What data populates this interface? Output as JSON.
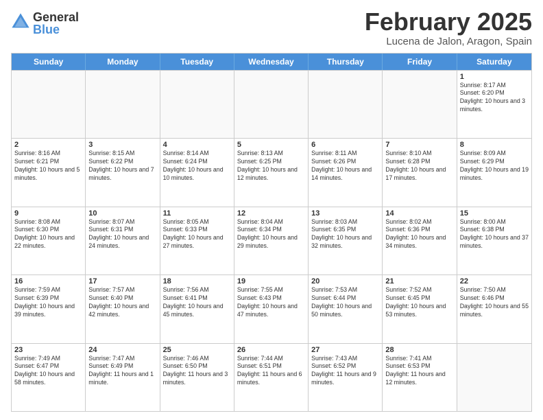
{
  "logo": {
    "general": "General",
    "blue": "Blue"
  },
  "header": {
    "month": "February 2025",
    "location": "Lucena de Jalon, Aragon, Spain"
  },
  "days_of_week": [
    "Sunday",
    "Monday",
    "Tuesday",
    "Wednesday",
    "Thursday",
    "Friday",
    "Saturday"
  ],
  "weeks": [
    [
      {
        "day": "",
        "empty": true
      },
      {
        "day": "",
        "empty": true
      },
      {
        "day": "",
        "empty": true
      },
      {
        "day": "",
        "empty": true
      },
      {
        "day": "",
        "empty": true
      },
      {
        "day": "",
        "empty": true
      },
      {
        "day": "1",
        "info": "Sunrise: 8:17 AM\nSunset: 6:20 PM\nDaylight: 10 hours and 3 minutes."
      }
    ],
    [
      {
        "day": "2",
        "info": "Sunrise: 8:16 AM\nSunset: 6:21 PM\nDaylight: 10 hours and 5 minutes."
      },
      {
        "day": "3",
        "info": "Sunrise: 8:15 AM\nSunset: 6:22 PM\nDaylight: 10 hours and 7 minutes."
      },
      {
        "day": "4",
        "info": "Sunrise: 8:14 AM\nSunset: 6:24 PM\nDaylight: 10 hours and 10 minutes."
      },
      {
        "day": "5",
        "info": "Sunrise: 8:13 AM\nSunset: 6:25 PM\nDaylight: 10 hours and 12 minutes."
      },
      {
        "day": "6",
        "info": "Sunrise: 8:11 AM\nSunset: 6:26 PM\nDaylight: 10 hours and 14 minutes."
      },
      {
        "day": "7",
        "info": "Sunrise: 8:10 AM\nSunset: 6:28 PM\nDaylight: 10 hours and 17 minutes."
      },
      {
        "day": "8",
        "info": "Sunrise: 8:09 AM\nSunset: 6:29 PM\nDaylight: 10 hours and 19 minutes."
      }
    ],
    [
      {
        "day": "9",
        "info": "Sunrise: 8:08 AM\nSunset: 6:30 PM\nDaylight: 10 hours and 22 minutes."
      },
      {
        "day": "10",
        "info": "Sunrise: 8:07 AM\nSunset: 6:31 PM\nDaylight: 10 hours and 24 minutes."
      },
      {
        "day": "11",
        "info": "Sunrise: 8:05 AM\nSunset: 6:33 PM\nDaylight: 10 hours and 27 minutes."
      },
      {
        "day": "12",
        "info": "Sunrise: 8:04 AM\nSunset: 6:34 PM\nDaylight: 10 hours and 29 minutes."
      },
      {
        "day": "13",
        "info": "Sunrise: 8:03 AM\nSunset: 6:35 PM\nDaylight: 10 hours and 32 minutes."
      },
      {
        "day": "14",
        "info": "Sunrise: 8:02 AM\nSunset: 6:36 PM\nDaylight: 10 hours and 34 minutes."
      },
      {
        "day": "15",
        "info": "Sunrise: 8:00 AM\nSunset: 6:38 PM\nDaylight: 10 hours and 37 minutes."
      }
    ],
    [
      {
        "day": "16",
        "info": "Sunrise: 7:59 AM\nSunset: 6:39 PM\nDaylight: 10 hours and 39 minutes."
      },
      {
        "day": "17",
        "info": "Sunrise: 7:57 AM\nSunset: 6:40 PM\nDaylight: 10 hours and 42 minutes."
      },
      {
        "day": "18",
        "info": "Sunrise: 7:56 AM\nSunset: 6:41 PM\nDaylight: 10 hours and 45 minutes."
      },
      {
        "day": "19",
        "info": "Sunrise: 7:55 AM\nSunset: 6:43 PM\nDaylight: 10 hours and 47 minutes."
      },
      {
        "day": "20",
        "info": "Sunrise: 7:53 AM\nSunset: 6:44 PM\nDaylight: 10 hours and 50 minutes."
      },
      {
        "day": "21",
        "info": "Sunrise: 7:52 AM\nSunset: 6:45 PM\nDaylight: 10 hours and 53 minutes."
      },
      {
        "day": "22",
        "info": "Sunrise: 7:50 AM\nSunset: 6:46 PM\nDaylight: 10 hours and 55 minutes."
      }
    ],
    [
      {
        "day": "23",
        "info": "Sunrise: 7:49 AM\nSunset: 6:47 PM\nDaylight: 10 hours and 58 minutes."
      },
      {
        "day": "24",
        "info": "Sunrise: 7:47 AM\nSunset: 6:49 PM\nDaylight: 11 hours and 1 minute."
      },
      {
        "day": "25",
        "info": "Sunrise: 7:46 AM\nSunset: 6:50 PM\nDaylight: 11 hours and 3 minutes."
      },
      {
        "day": "26",
        "info": "Sunrise: 7:44 AM\nSunset: 6:51 PM\nDaylight: 11 hours and 6 minutes."
      },
      {
        "day": "27",
        "info": "Sunrise: 7:43 AM\nSunset: 6:52 PM\nDaylight: 11 hours and 9 minutes."
      },
      {
        "day": "28",
        "info": "Sunrise: 7:41 AM\nSunset: 6:53 PM\nDaylight: 11 hours and 12 minutes."
      },
      {
        "day": "",
        "empty": true
      }
    ]
  ]
}
